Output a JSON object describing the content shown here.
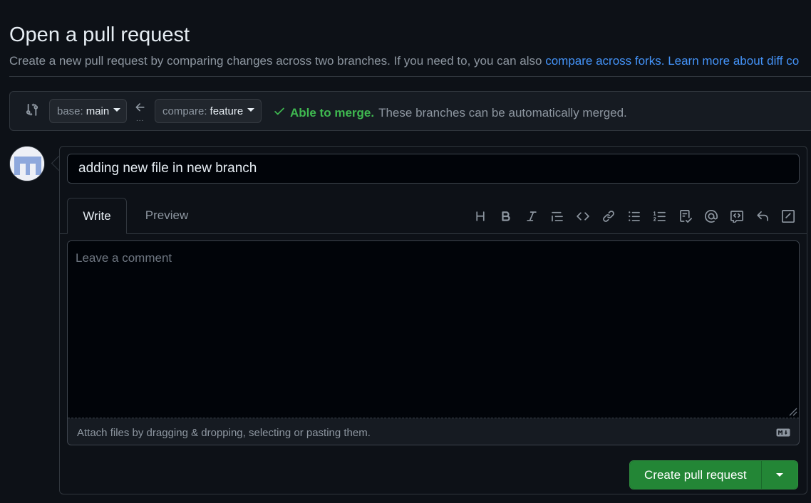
{
  "page": {
    "title": "Open a pull request",
    "subtitle_text": "Create a new pull request by comparing changes across two branches. If you need to, you can also ",
    "subtitle_link1": "compare across forks.",
    "subtitle_link2": "Learn more about diff co"
  },
  "range": {
    "base_label": "base:",
    "base_value": "main",
    "dots": "...",
    "compare_label": "compare:",
    "compare_value": "feature",
    "merge_ok": "Able to merge.",
    "merge_msg": "These branches can be automatically merged."
  },
  "form": {
    "title_value": "adding new file in new branch",
    "tabs": [
      {
        "label": "Write",
        "active": true
      },
      {
        "label": "Preview",
        "active": false
      }
    ],
    "toolbar_icons": [
      "heading-icon",
      "bold-icon",
      "italic-icon",
      "quote-icon",
      "code-icon",
      "link-icon",
      "unordered-list-icon",
      "ordered-list-icon",
      "task-list-icon",
      "mention-icon",
      "reference-icon",
      "reply-icon",
      "slash-command-icon"
    ],
    "comment_placeholder": "Leave a comment",
    "comment_value": "",
    "attach_hint": "Attach files by dragging & dropping, selecting or pasting them.",
    "submit_label": "Create pull request"
  },
  "colors": {
    "background": "#0d1117",
    "accent_link": "#4493f8",
    "success": "#3fb950",
    "primary_button": "#238636"
  }
}
